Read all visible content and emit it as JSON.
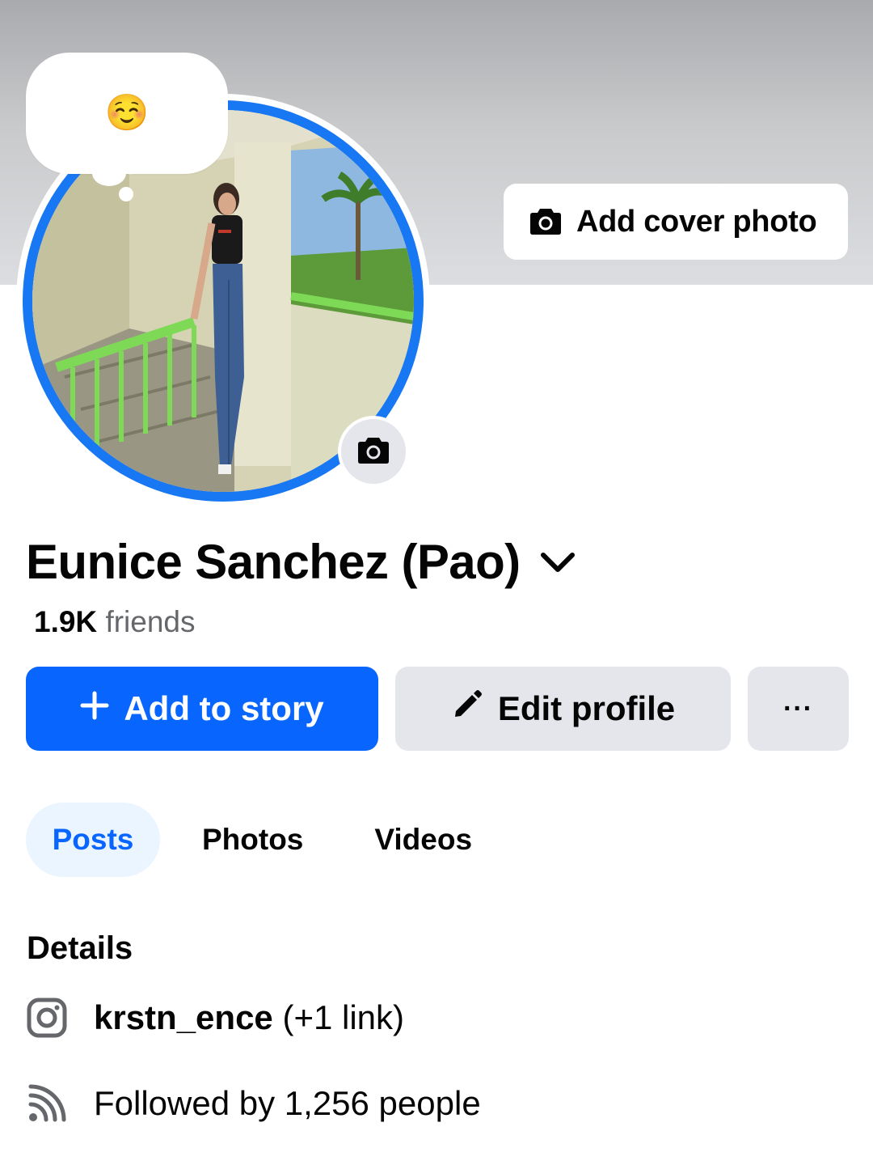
{
  "cover": {
    "button_label": "Add cover photo",
    "button_icon": "camera-icon"
  },
  "note": {
    "emoji": "☺️"
  },
  "profile": {
    "name": "Eunice Sanchez (Pao)",
    "friends_count": "1.9K",
    "friends_label": "friends"
  },
  "actions": {
    "add_story": "Add to story",
    "edit_profile": "Edit profile",
    "more": "···"
  },
  "tabs": [
    {
      "label": "Posts",
      "active": true
    },
    {
      "label": "Photos",
      "active": false
    },
    {
      "label": "Videos",
      "active": false
    }
  ],
  "details": {
    "heading": "Details",
    "instagram_handle": "krstn_ence",
    "instagram_extra": "(+1 link)",
    "followers_text": "Followed by 1,256 people"
  },
  "colors": {
    "accent": "#0866ff",
    "ring": "#1877f2",
    "button_grey": "#e4e6eb",
    "tab_active_bg": "#ebf5ff"
  }
}
